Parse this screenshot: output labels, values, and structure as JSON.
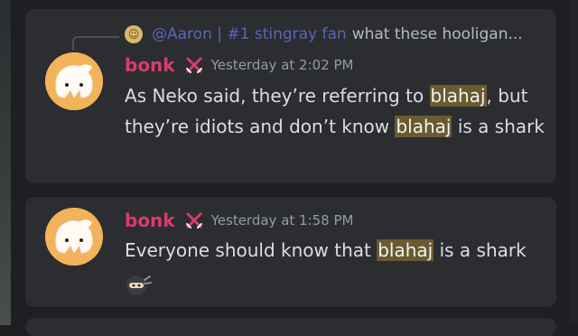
{
  "reply": {
    "mention": "@Aaron | #1 stingray fan",
    "snippet": "what these hooligan..."
  },
  "messages": [
    {
      "username": "bonk",
      "timestamp": "Yesterday at 2:02 PM",
      "text_parts": [
        "As Neko said, they’re referring to ",
        "blahaj",
        ", but they’re idiots and don’t know ",
        "blahaj",
        " is a shark"
      ]
    },
    {
      "username": "bonk",
      "timestamp": "Yesterday at 1:58 PM",
      "text_parts": [
        "Everyone should know that ",
        "blahaj",
        " is a shark"
      ]
    }
  ],
  "colors": {
    "username": "#d83c6b",
    "highlight": "#6a5a30",
    "card_bg": "#2b2d31",
    "page_bg": "#1e1f22"
  },
  "icons": {
    "role": "crossed-swords-icon",
    "reply_avatar": "avatar-icon",
    "emoji": "ninja-emoji-icon"
  }
}
